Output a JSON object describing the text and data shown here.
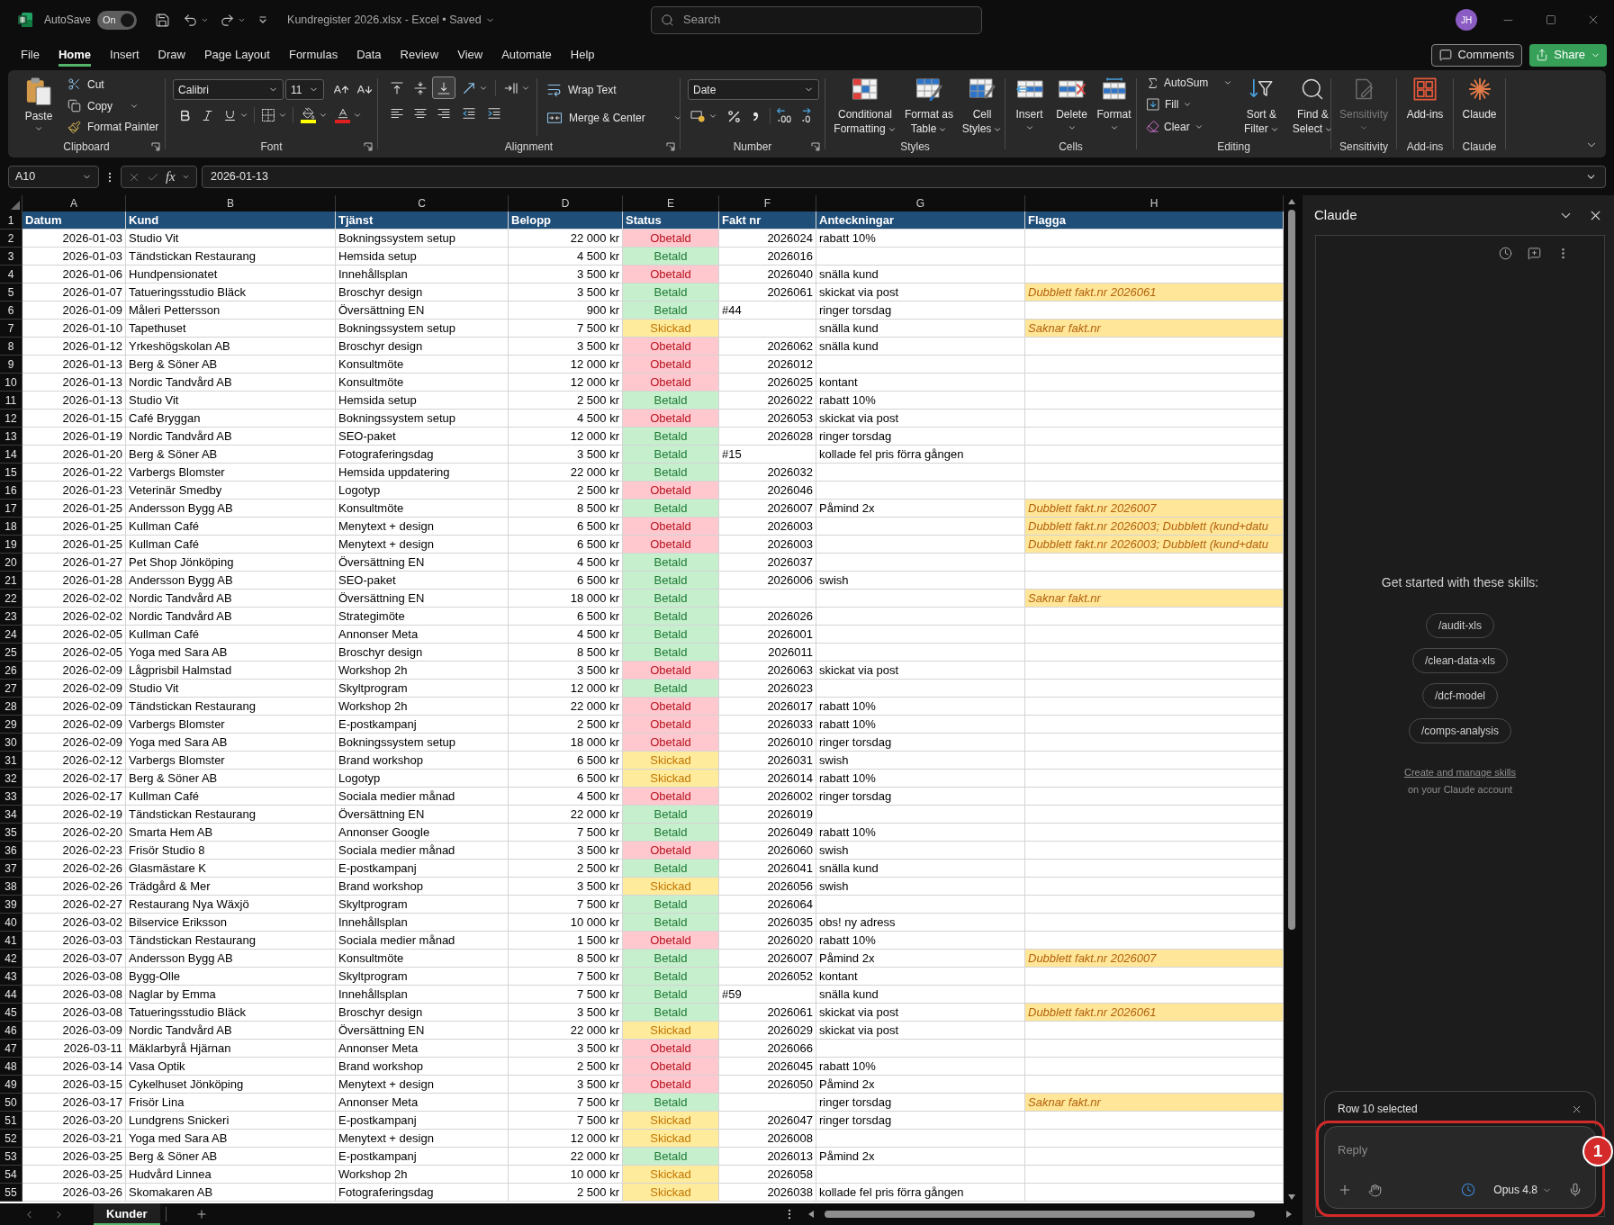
{
  "title_bar": {
    "autosave_label": "AutoSave",
    "autosave": {
      "on": true,
      "label": "On"
    },
    "document_title": "Kundregister 2026.xlsx - Excel • Saved",
    "search": {
      "placeholder": "Search"
    },
    "avatar": "JH"
  },
  "menu": {
    "tabs": [
      {
        "label": "File",
        "selected": false
      },
      {
        "label": "Home",
        "selected": true
      },
      {
        "label": "Insert",
        "selected": false
      },
      {
        "label": "Draw",
        "selected": false
      },
      {
        "label": "Page Layout",
        "selected": false
      },
      {
        "label": "Formulas",
        "selected": false
      },
      {
        "label": "Data",
        "selected": false
      },
      {
        "label": "Review",
        "selected": false
      },
      {
        "label": "View",
        "selected": false
      },
      {
        "label": "Automate",
        "selected": false
      },
      {
        "label": "Help",
        "selected": false
      }
    ],
    "comments": "Comments",
    "share": "Share"
  },
  "ribbon": {
    "clipboard": {
      "label": "Clipboard",
      "paste": "Paste",
      "cut": "Cut",
      "copy": "Copy",
      "format_painter": "Format Painter"
    },
    "font": {
      "label": "Font",
      "font_name": "Calibri",
      "font_size": "11"
    },
    "alignment": {
      "label": "Alignment",
      "vertical": [
        {
          "kind": "top",
          "selected": false
        },
        {
          "kind": "middle",
          "selected": false
        },
        {
          "kind": "bottom",
          "selected": true
        }
      ],
      "wrap_text": "Wrap Text",
      "merge_center": "Merge & Center"
    },
    "number": {
      "label": "Number",
      "format": "Date"
    },
    "styles": {
      "label": "Styles",
      "buttons": [
        {
          "kind": "conditional",
          "label": "Conditional Formatting"
        },
        {
          "kind": "table",
          "label": "Format as Table"
        },
        {
          "kind": "cell_styles",
          "label": "Cell Styles"
        }
      ]
    },
    "cells": {
      "label": "Cells",
      "buttons": [
        {
          "kind": "insert",
          "label": "Insert"
        },
        {
          "kind": "delete",
          "label": "Delete"
        },
        {
          "kind": "format",
          "label": "Format"
        }
      ]
    },
    "editing": {
      "label": "Editing",
      "autosum": "AutoSum",
      "fill": "Fill",
      "clear": "Clear",
      "sort_filter": "Sort & Filter",
      "find_select": "Find & Select"
    },
    "sensitivity": {
      "label": "Sensitivity",
      "button": {
        "label": "Sensitivity",
        "disabled": true
      }
    },
    "addins": {
      "label": "Add-ins",
      "button": "Add-ins"
    },
    "claude": {
      "label": "Claude",
      "button": "Claude"
    }
  },
  "formula_bar": {
    "name_box": "A10",
    "function_label": "fx",
    "value": "2026-01-13"
  },
  "sheet": {
    "columns": [
      "A",
      "B",
      "C",
      "D",
      "E",
      "F",
      "G",
      "H"
    ],
    "header": {
      "row": "1",
      "cells": [
        "Datum",
        "Kund",
        "Tjänst",
        "Belopp",
        "Status",
        "Fakt nr",
        "Anteckningar",
        "Flagga"
      ]
    },
    "rows": [
      {
        "row": "2",
        "date": "2026-01-03",
        "customer": "Studio Vit",
        "service": "Bokningssystem setup",
        "amount": "22 000 kr",
        "status": {
          "text": "Obetald",
          "kind": "unpaid"
        },
        "invoice": {
          "text": "2026024",
          "kind": "number"
        },
        "note": "rabatt 10%"
      },
      {
        "row": "3",
        "date": "2026-01-03",
        "customer": "Tändstickan Restaurang",
        "service": "Hemsida setup",
        "amount": "4 500 kr",
        "status": {
          "text": "Betald",
          "kind": "paid"
        },
        "invoice": {
          "text": "2026016",
          "kind": "number"
        }
      },
      {
        "row": "4",
        "date": "2026-01-06",
        "customer": "Hundpensionatet",
        "service": "Innehållsplan",
        "amount": "3 500 kr",
        "status": {
          "text": "Obetald",
          "kind": "unpaid"
        },
        "invoice": {
          "text": "2026040",
          "kind": "number"
        },
        "note": "snälla kund"
      },
      {
        "row": "5",
        "date": "2026-01-07",
        "customer": "Tatueringsstudio Bläck",
        "service": "Broschyr design",
        "amount": "3 500 kr",
        "status": {
          "text": "Betald",
          "kind": "paid"
        },
        "invoice": {
          "text": "2026061",
          "kind": "number"
        },
        "note": "skickat via post",
        "flag": "Dubblett fakt.nr 2026061"
      },
      {
        "row": "6",
        "date": "2026-01-09",
        "customer": "Måleri Pettersson",
        "service": "Översättning EN",
        "amount": "900 kr",
        "status": {
          "text": "Betald",
          "kind": "paid"
        },
        "invoice": {
          "text": "#44",
          "kind": "text"
        },
        "note": "ringer torsdag"
      },
      {
        "row": "7",
        "date": "2026-01-10",
        "customer": "Tapethuset",
        "service": "Bokningssystem setup",
        "amount": "7 500 kr",
        "status": {
          "text": "Skickad",
          "kind": "sent"
        },
        "note": "snälla kund",
        "flag": "Saknar fakt.nr"
      },
      {
        "row": "8",
        "date": "2026-01-12",
        "customer": "Yrkeshögskolan AB",
        "service": "Broschyr design",
        "amount": "3 500 kr",
        "status": {
          "text": "Obetald",
          "kind": "unpaid"
        },
        "invoice": {
          "text": "2026062",
          "kind": "number"
        },
        "note": "snälla kund"
      },
      {
        "row": "9",
        "date": "2026-01-13",
        "customer": "Berg & Söner AB",
        "service": "Konsultmöte",
        "amount": "12 000 kr",
        "status": {
          "text": "Obetald",
          "kind": "unpaid"
        },
        "invoice": {
          "text": "2026012",
          "kind": "number"
        }
      },
      {
        "row": "10",
        "date": "2026-01-13",
        "customer": "Nordic Tandvård AB",
        "service": "Konsultmöte",
        "amount": "12 000 kr",
        "status": {
          "text": "Obetald",
          "kind": "unpaid"
        },
        "invoice": {
          "text": "2026025",
          "kind": "number"
        },
        "note": "kontant"
      },
      {
        "row": "11",
        "date": "2026-01-13",
        "customer": "Studio Vit",
        "service": "Hemsida setup",
        "amount": "2 500 kr",
        "status": {
          "text": "Betald",
          "kind": "paid"
        },
        "invoice": {
          "text": "2026022",
          "kind": "number"
        },
        "note": "rabatt 10%"
      },
      {
        "row": "12",
        "date": "2026-01-15",
        "customer": "Café Bryggan",
        "service": "Bokningssystem setup",
        "amount": "4 500 kr",
        "status": {
          "text": "Obetald",
          "kind": "unpaid"
        },
        "invoice": {
          "text": "2026053",
          "kind": "number"
        },
        "note": "skickat via post"
      },
      {
        "row": "13",
        "date": "2026-01-19",
        "customer": "Nordic Tandvård AB",
        "service": "SEO-paket",
        "amount": "12 000 kr",
        "status": {
          "text": "Betald",
          "kind": "paid"
        },
        "invoice": {
          "text": "2026028",
          "kind": "number"
        },
        "note": "ringer torsdag"
      },
      {
        "row": "14",
        "date": "2026-01-20",
        "customer": "Berg & Söner AB",
        "service": "Fotograferingsdag",
        "amount": "3 500 kr",
        "status": {
          "text": "Betald",
          "kind": "paid"
        },
        "invoice": {
          "text": "#15",
          "kind": "text"
        },
        "note": "kollade fel pris förra gången"
      },
      {
        "row": "15",
        "date": "2026-01-22",
        "customer": "Varbergs Blomster",
        "service": "Hemsida uppdatering",
        "amount": "22 000 kr",
        "status": {
          "text": "Betald",
          "kind": "paid"
        },
        "invoice": {
          "text": "2026032",
          "kind": "number"
        }
      },
      {
        "row": "16",
        "date": "2026-01-23",
        "customer": "Veterinär Smedby",
        "service": "Logotyp",
        "amount": "2 500 kr",
        "status": {
          "text": "Obetald",
          "kind": "unpaid"
        },
        "invoice": {
          "text": "2026046",
          "kind": "number"
        }
      },
      {
        "row": "17",
        "date": "2026-01-25",
        "customer": "Andersson Bygg AB",
        "service": "Konsultmöte",
        "amount": "8 500 kr",
        "status": {
          "text": "Betald",
          "kind": "paid"
        },
        "invoice": {
          "text": "2026007",
          "kind": "number"
        },
        "note": "Påmind 2x",
        "flag": "Dubblett fakt.nr 2026007"
      },
      {
        "row": "18",
        "date": "2026-01-25",
        "customer": "Kullman Café",
        "service": "Menytext + design",
        "amount": "6 500 kr",
        "status": {
          "text": "Obetald",
          "kind": "unpaid"
        },
        "invoice": {
          "text": "2026003",
          "kind": "number"
        },
        "flag": "Dubblett fakt.nr 2026003; Dubblett (kund+datu"
      },
      {
        "row": "19",
        "date": "2026-01-25",
        "customer": "Kullman Café",
        "service": "Menytext + design",
        "amount": "6 500 kr",
        "status": {
          "text": "Obetald",
          "kind": "unpaid"
        },
        "invoice": {
          "text": "2026003",
          "kind": "number"
        },
        "flag": "Dubblett fakt.nr 2026003; Dubblett (kund+datu"
      },
      {
        "row": "20",
        "date": "2026-01-27",
        "customer": "Pet Shop Jönköping",
        "service": "Översättning EN",
        "amount": "4 500 kr",
        "status": {
          "text": "Betald",
          "kind": "paid"
        },
        "invoice": {
          "text": "2026037",
          "kind": "number"
        }
      },
      {
        "row": "21",
        "date": "2026-01-28",
        "customer": "Andersson Bygg AB",
        "service": "SEO-paket",
        "amount": "6 500 kr",
        "status": {
          "text": "Betald",
          "kind": "paid"
        },
        "invoice": {
          "text": "2026006",
          "kind": "number"
        },
        "note": "swish"
      },
      {
        "row": "22",
        "date": "2026-02-02",
        "customer": "Nordic Tandvård AB",
        "service": "Översättning EN",
        "amount": "18 000 kr",
        "status": {
          "text": "Betald",
          "kind": "paid"
        },
        "flag": "Saknar fakt.nr"
      },
      {
        "row": "23",
        "date": "2026-02-02",
        "customer": "Nordic Tandvård AB",
        "service": "Strategimöte",
        "amount": "6 500 kr",
        "status": {
          "text": "Betald",
          "kind": "paid"
        },
        "invoice": {
          "text": "2026026",
          "kind": "number"
        }
      },
      {
        "row": "24",
        "date": "2026-02-05",
        "customer": "Kullman Café",
        "service": "Annonser Meta",
        "amount": "4 500 kr",
        "status": {
          "text": "Betald",
          "kind": "paid"
        },
        "invoice": {
          "text": "2026001",
          "kind": "number"
        }
      },
      {
        "row": "25",
        "date": "2026-02-05",
        "customer": "Yoga med Sara AB",
        "service": "Broschyr design",
        "amount": "8 500 kr",
        "status": {
          "text": "Betald",
          "kind": "paid"
        },
        "invoice": {
          "text": "2026011",
          "kind": "number"
        }
      },
      {
        "row": "26",
        "date": "2026-02-09",
        "customer": "Lågprisbil Halmstad",
        "service": "Workshop 2h",
        "amount": "3 500 kr",
        "status": {
          "text": "Obetald",
          "kind": "unpaid"
        },
        "invoice": {
          "text": "2026063",
          "kind": "number"
        },
        "note": "skickat via post"
      },
      {
        "row": "27",
        "date": "2026-02-09",
        "customer": "Studio Vit",
        "service": "Skyltprogram",
        "amount": "12 000 kr",
        "status": {
          "text": "Betald",
          "kind": "paid"
        },
        "invoice": {
          "text": "2026023",
          "kind": "number"
        }
      },
      {
        "row": "28",
        "date": "2026-02-09",
        "customer": "Tändstickan Restaurang",
        "service": "Workshop 2h",
        "amount": "22 000 kr",
        "status": {
          "text": "Obetald",
          "kind": "unpaid"
        },
        "invoice": {
          "text": "2026017",
          "kind": "number"
        },
        "note": "rabatt 10%"
      },
      {
        "row": "29",
        "date": "2026-02-09",
        "customer": "Varbergs Blomster",
        "service": "E-postkampanj",
        "amount": "2 500 kr",
        "status": {
          "text": "Obetald",
          "kind": "unpaid"
        },
        "invoice": {
          "text": "2026033",
          "kind": "number"
        },
        "note": "rabatt 10%"
      },
      {
        "row": "30",
        "date": "2026-02-09",
        "customer": "Yoga med Sara AB",
        "service": "Bokningssystem setup",
        "amount": "18 000 kr",
        "status": {
          "text": "Obetald",
          "kind": "unpaid"
        },
        "invoice": {
          "text": "2026010",
          "kind": "number"
        },
        "note": "ringer torsdag"
      },
      {
        "row": "31",
        "date": "2026-02-12",
        "customer": "Varbergs Blomster",
        "service": "Brand workshop",
        "amount": "6 500 kr",
        "status": {
          "text": "Skickad",
          "kind": "sent"
        },
        "invoice": {
          "text": "2026031",
          "kind": "number"
        },
        "note": "swish"
      },
      {
        "row": "32",
        "date": "2026-02-17",
        "customer": "Berg & Söner AB",
        "service": "Logotyp",
        "amount": "6 500 kr",
        "status": {
          "text": "Skickad",
          "kind": "sent"
        },
        "invoice": {
          "text": "2026014",
          "kind": "number"
        },
        "note": "rabatt 10%"
      },
      {
        "row": "33",
        "date": "2026-02-17",
        "customer": "Kullman Café",
        "service": "Sociala medier månad",
        "amount": "4 500 kr",
        "status": {
          "text": "Obetald",
          "kind": "unpaid"
        },
        "invoice": {
          "text": "2026002",
          "kind": "number"
        },
        "note": "ringer torsdag"
      },
      {
        "row": "34",
        "date": "2026-02-19",
        "customer": "Tändstickan Restaurang",
        "service": "Översättning EN",
        "amount": "22 000 kr",
        "status": {
          "text": "Betald",
          "kind": "paid"
        },
        "invoice": {
          "text": "2026019",
          "kind": "number"
        }
      },
      {
        "row": "35",
        "date": "2026-02-20",
        "customer": "Smarta Hem AB",
        "service": "Annonser Google",
        "amount": "7 500 kr",
        "status": {
          "text": "Betald",
          "kind": "paid"
        },
        "invoice": {
          "text": "2026049",
          "kind": "number"
        },
        "note": "rabatt 10%"
      },
      {
        "row": "36",
        "date": "2026-02-23",
        "customer": "Frisör Studio 8",
        "service": "Sociala medier månad",
        "amount": "3 500 kr",
        "status": {
          "text": "Obetald",
          "kind": "unpaid"
        },
        "invoice": {
          "text": "2026060",
          "kind": "number"
        },
        "note": "swish"
      },
      {
        "row": "37",
        "date": "2026-02-26",
        "customer": "Glasmästare K",
        "service": "E-postkampanj",
        "amount": "2 500 kr",
        "status": {
          "text": "Betald",
          "kind": "paid"
        },
        "invoice": {
          "text": "2026041",
          "kind": "number"
        },
        "note": "snälla kund"
      },
      {
        "row": "38",
        "date": "2026-02-26",
        "customer": "Trädgård & Mer",
        "service": "Brand workshop",
        "amount": "3 500 kr",
        "status": {
          "text": "Skickad",
          "kind": "sent"
        },
        "invoice": {
          "text": "2026056",
          "kind": "number"
        },
        "note": "swish"
      },
      {
        "row": "39",
        "date": "2026-02-27",
        "customer": "Restaurang Nya Wäxjö",
        "service": "Skyltprogram",
        "amount": "7 500 kr",
        "status": {
          "text": "Betald",
          "kind": "paid"
        },
        "invoice": {
          "text": "2026064",
          "kind": "number"
        }
      },
      {
        "row": "40",
        "date": "2026-03-02",
        "customer": "Bilservice Eriksson",
        "service": "Innehållsplan",
        "amount": "10 000 kr",
        "status": {
          "text": "Betald",
          "kind": "paid"
        },
        "invoice": {
          "text": "2026035",
          "kind": "number"
        },
        "note": "obs! ny adress"
      },
      {
        "row": "41",
        "date": "2026-03-03",
        "customer": "Tändstickan Restaurang",
        "service": "Sociala medier månad",
        "amount": "1 500 kr",
        "status": {
          "text": "Obetald",
          "kind": "unpaid"
        },
        "invoice": {
          "text": "2026020",
          "kind": "number"
        },
        "note": "rabatt 10%"
      },
      {
        "row": "42",
        "date": "2026-03-07",
        "customer": "Andersson Bygg AB",
        "service": "Konsultmöte",
        "amount": "8 500 kr",
        "status": {
          "text": "Betald",
          "kind": "paid"
        },
        "invoice": {
          "text": "2026007",
          "kind": "number"
        },
        "note": "Påmind 2x",
        "flag": "Dubblett fakt.nr 2026007"
      },
      {
        "row": "43",
        "date": "2026-03-08",
        "customer": "Bygg-Olle",
        "service": "Skyltprogram",
        "amount": "7 500 kr",
        "status": {
          "text": "Betald",
          "kind": "paid"
        },
        "invoice": {
          "text": "2026052",
          "kind": "number"
        },
        "note": "kontant"
      },
      {
        "row": "44",
        "date": "2026-03-08",
        "customer": "Naglar by Emma",
        "service": "Innehållsplan",
        "amount": "7 500 kr",
        "status": {
          "text": "Betald",
          "kind": "paid"
        },
        "invoice": {
          "text": "#59",
          "kind": "text"
        },
        "note": "snälla kund"
      },
      {
        "row": "45",
        "date": "2026-03-08",
        "customer": "Tatueringsstudio Bläck",
        "service": "Broschyr design",
        "amount": "3 500 kr",
        "status": {
          "text": "Betald",
          "kind": "paid"
        },
        "invoice": {
          "text": "2026061",
          "kind": "number"
        },
        "note": "skickat via post",
        "flag": "Dubblett fakt.nr 2026061"
      },
      {
        "row": "46",
        "date": "2026-03-09",
        "customer": "Nordic Tandvård AB",
        "service": "Översättning EN",
        "amount": "22 000 kr",
        "status": {
          "text": "Skickad",
          "kind": "sent"
        },
        "invoice": {
          "text": "2026029",
          "kind": "number"
        },
        "note": "skickat via post"
      },
      {
        "row": "47",
        "date": "2026-03-11",
        "customer": "Mäklarbyrå Hjärnan",
        "service": "Annonser Meta",
        "amount": "3 500 kr",
        "status": {
          "text": "Obetald",
          "kind": "unpaid"
        },
        "invoice": {
          "text": "2026066",
          "kind": "number"
        }
      },
      {
        "row": "48",
        "date": "2026-03-14",
        "customer": "Vasa Optik",
        "service": "Brand workshop",
        "amount": "2 500 kr",
        "status": {
          "text": "Obetald",
          "kind": "unpaid"
        },
        "invoice": {
          "text": "2026045",
          "kind": "number"
        },
        "note": "rabatt 10%"
      },
      {
        "row": "49",
        "date": "2026-03-15",
        "customer": "Cykelhuset Jönköping",
        "service": "Menytext + design",
        "amount": "3 500 kr",
        "status": {
          "text": "Obetald",
          "kind": "unpaid"
        },
        "invoice": {
          "text": "2026050",
          "kind": "number"
        },
        "note": "Påmind 2x"
      },
      {
        "row": "50",
        "date": "2026-03-17",
        "customer": "Frisör Lina",
        "service": "Annonser Meta",
        "amount": "7 500 kr",
        "status": {
          "text": "Betald",
          "kind": "paid"
        },
        "note": "ringer torsdag",
        "flag": "Saknar fakt.nr"
      },
      {
        "row": "51",
        "date": "2026-03-20",
        "customer": "Lundgrens Snickeri",
        "service": "E-postkampanj",
        "amount": "7 500 kr",
        "status": {
          "text": "Skickad",
          "kind": "sent"
        },
        "invoice": {
          "text": "2026047",
          "kind": "number"
        },
        "note": "ringer torsdag"
      },
      {
        "row": "52",
        "date": "2026-03-21",
        "customer": "Yoga med Sara AB",
        "service": "Menytext + design",
        "amount": "12 000 kr",
        "status": {
          "text": "Skickad",
          "kind": "sent"
        },
        "invoice": {
          "text": "2026008",
          "kind": "number"
        }
      },
      {
        "row": "53",
        "date": "2026-03-25",
        "customer": "Berg & Söner AB",
        "service": "E-postkampanj",
        "amount": "22 000 kr",
        "status": {
          "text": "Betald",
          "kind": "paid"
        },
        "invoice": {
          "text": "2026013",
          "kind": "number"
        },
        "note": "Påmind 2x"
      },
      {
        "row": "54",
        "date": "2026-03-25",
        "customer": "Hudvård Linnea",
        "service": "Workshop 2h",
        "amount": "10 000 kr",
        "status": {
          "text": "Skickad",
          "kind": "sent"
        },
        "invoice": {
          "text": "2026058",
          "kind": "number"
        }
      },
      {
        "row": "55",
        "date": "2026-03-26",
        "customer": "Skomakaren AB",
        "service": "Fotograferingsdag",
        "amount": "2 500 kr",
        "status": {
          "text": "Skickad",
          "kind": "sent"
        },
        "invoice": {
          "text": "2026038",
          "kind": "number"
        },
        "note": "kollade fel pris förra gången"
      }
    ],
    "tabs": [
      {
        "label": "Kunder",
        "selected": true
      }
    ]
  },
  "claude_panel": {
    "title": "Claude",
    "intro": "Get started with these skills:",
    "skills": [
      {
        "label": "/audit-xls"
      },
      {
        "label": "/clean-data-xls"
      },
      {
        "label": "/dcf-model"
      },
      {
        "label": "/comps-analysis"
      }
    ],
    "manage_link": "Create and manage skills",
    "manage_note": "on your Claude account",
    "context": "Row 10 selected",
    "reply": {
      "placeholder": "Reply"
    },
    "model": "Opus 4.8"
  },
  "annotation": {
    "label": "1"
  }
}
